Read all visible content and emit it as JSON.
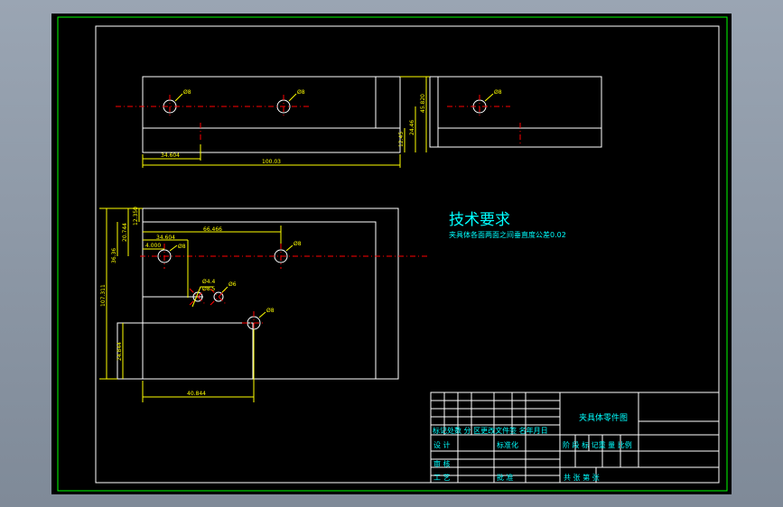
{
  "colors": {
    "background": "#000000",
    "frame_outer": "#00ff00",
    "frame_inner": "#ffffff",
    "geometry": "#ffffff",
    "dimension": "#ffff00",
    "centerline": "#ff0000",
    "annotation": "#00ffff"
  },
  "tech_requirements": {
    "title": "技术要求",
    "line1": "夹具体各面两面之间垂直度公差0.02"
  },
  "dimensions": {
    "top_view": {
      "hole_1": "Ø8",
      "hole_2": "Ø8",
      "side_hole": "Ø8",
      "d_34": "34.604",
      "d_100": "100.03",
      "d_12": "12.45",
      "d_24": "24.46",
      "d_45": "45.820"
    },
    "front_view": {
      "d_12_350": "12.350",
      "d_20": "20.744",
      "d_36": "36.36",
      "d_107": "107.311",
      "d_24": "24.844",
      "d_34": "34.604",
      "d_66": "66.466",
      "d_small": "4.000",
      "hole_a": "Ø8",
      "hole_b": "Ø8",
      "hole_c": "Ø4.4",
      "hole_c2": "Ø8.5",
      "hole_d": "Ø6",
      "hole_e": "Ø8",
      "d_bottom": "40.844"
    }
  },
  "title_block": {
    "drawing_name": "夹具体零件图",
    "row_labels": "标记处数 分 区更改文件签 名年月日",
    "design": "设 计",
    "standardize": "标准化",
    "stage_labels": "阶 段 标 记重 量 比例",
    "review": "审 核",
    "process": "工 艺",
    "approve": "批 准",
    "sheet_info": "共 张 第 张"
  }
}
